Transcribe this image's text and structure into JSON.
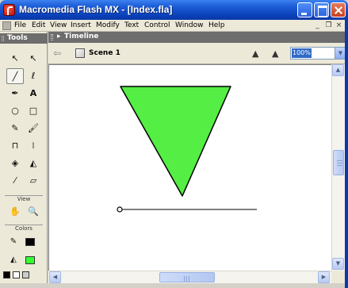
{
  "window": {
    "title": "Macromedia Flash MX - [Index.fla]",
    "controls": {
      "minimize": "minimize",
      "maximize": "maximize",
      "close": "close"
    }
  },
  "menubar": {
    "items": [
      "File",
      "Edit",
      "View",
      "Insert",
      "Modify",
      "Text",
      "Control",
      "Window",
      "Help"
    ],
    "mdi_controls": [
      "_",
      "❐",
      "×"
    ]
  },
  "tools_panel": {
    "title": "Tools",
    "tools": [
      {
        "name": "arrow-tool",
        "glyph": "↖"
      },
      {
        "name": "subselect-tool",
        "glyph": "↖"
      },
      {
        "name": "line-tool",
        "glyph": "╱"
      },
      {
        "name": "lasso-tool",
        "glyph": "ℓ"
      },
      {
        "name": "pen-tool",
        "glyph": "✒"
      },
      {
        "name": "text-tool",
        "glyph": "A"
      },
      {
        "name": "oval-tool",
        "glyph": "○"
      },
      {
        "name": "rectangle-tool",
        "glyph": "□"
      },
      {
        "name": "pencil-tool",
        "glyph": "✎"
      },
      {
        "name": "brush-tool",
        "glyph": "🖌"
      },
      {
        "name": "free-transform-tool",
        "glyph": "⊓"
      },
      {
        "name": "fill-transform-tool",
        "glyph": "⁞"
      },
      {
        "name": "ink-bottle-tool",
        "glyph": "◈"
      },
      {
        "name": "paint-bucket-tool",
        "glyph": "◭"
      },
      {
        "name": "eyedropper-tool",
        "glyph": "⁄"
      },
      {
        "name": "eraser-tool",
        "glyph": "▱"
      }
    ],
    "view_section": {
      "label": "View",
      "tools": [
        {
          "name": "hand-tool",
          "glyph": "✋"
        },
        {
          "name": "zoom-tool",
          "glyph": "🔍"
        }
      ]
    },
    "colors_section": {
      "label": "Colors",
      "stroke_color": "#000000",
      "fill_color": "#33ff33"
    }
  },
  "timeline": {
    "label": "Timeline",
    "arrow": "▸"
  },
  "editbar": {
    "back": "⇦",
    "scene_label": "Scene 1",
    "edit_symbol": "▲",
    "edit_object": "▲",
    "zoom": "100%"
  },
  "stage": {
    "triangle_fill": "#55ee44",
    "triangle_stroke": "#000000",
    "line_color": "#000000"
  }
}
